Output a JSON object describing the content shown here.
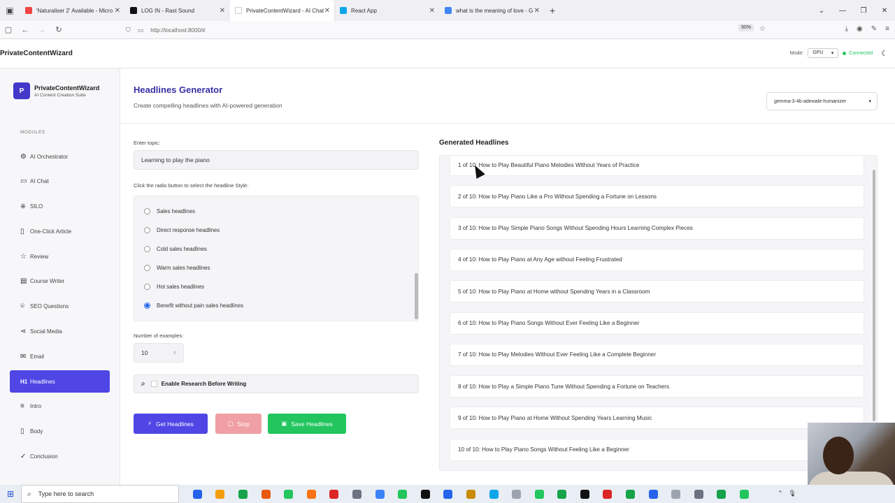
{
  "browser": {
    "tabs": [
      {
        "label": "'Naturaliser 2' Available - Micro",
        "color": "#ef4444"
      },
      {
        "label": "LOG IN - Rast Sound",
        "color": "#111111"
      },
      {
        "label": "PrivateContentWizard - AI Chat",
        "color": "#ffffff"
      },
      {
        "label": "React App",
        "color": "#0ea5e9"
      },
      {
        "label": "what is the meaning of love - G",
        "color": "#4285f4"
      }
    ],
    "url": "http://localhost:8000/#",
    "zoom": "90%"
  },
  "header": {
    "app_name": "PrivateContentWizard",
    "mode_label": "Mode:",
    "mode_value": "GPU",
    "status": "Connected"
  },
  "sidebar": {
    "brand_initial": "P",
    "brand_name": "PrivateContentWizard",
    "brand_sub": "AI Content Creation Suite",
    "modules_label": "MODULES",
    "items": [
      {
        "label": "AI Orchestrator",
        "icon": "⚙"
      },
      {
        "label": "AI Chat",
        "icon": "▭"
      },
      {
        "label": "SILO",
        "icon": "⎈"
      },
      {
        "label": "One-Click Article",
        "icon": "▯"
      },
      {
        "label": "Review",
        "icon": "☆"
      },
      {
        "label": "Course Writer",
        "icon": "▤"
      },
      {
        "label": "SEO Questions",
        "icon": "⌾"
      },
      {
        "label": "Social Media",
        "icon": "⋖"
      },
      {
        "label": "Email",
        "icon": "✉"
      },
      {
        "label": "Headlines",
        "icon": "H1"
      },
      {
        "label": "Intro",
        "icon": "≡"
      },
      {
        "label": "Body",
        "icon": "▯"
      },
      {
        "label": "Conclusion",
        "icon": "✓"
      }
    ]
  },
  "page": {
    "title": "Headlines Generator",
    "subtitle": "Create compelling headlines with AI-powered generation",
    "model": "gemma-3-4b-adewale-humanizer",
    "topic_label": "Enter topic:",
    "topic_value": "Learning to play the piano",
    "radio_label": "Click the radio button to select the headline Style:",
    "styles": [
      {
        "label": "Sales headlines",
        "checked": false
      },
      {
        "label": "Direct response headlines",
        "checked": false
      },
      {
        "label": "Cold sales headlines",
        "checked": false
      },
      {
        "label": "Warm sales headlines",
        "checked": false
      },
      {
        "label": "Hot sales headlines",
        "checked": false
      },
      {
        "label": "Benefit without pain sales headlines",
        "checked": true
      }
    ],
    "examples_label": "Number of examples:",
    "examples_value": "10",
    "research_label": "Enable Research Before Writing",
    "buttons": {
      "get": "Get Headlines",
      "stop": "Stop",
      "save": "Save Headlines"
    },
    "generated_title": "Generated Headlines",
    "headlines": [
      "1 of 10: How to Play Beautiful Piano Melodies Without Years of Practice",
      "2 of 10: How to Play Piano Like a Pro Without Spending a Fortune on Lessons",
      "3 of 10: How to Play Simple Piano Songs Without Spending Hours Learning Complex Pieces",
      "4 of 10: How to Play Piano at Any Age without Feeling Frustrated",
      "5 of 10: How to Play Piano at Home without Spending Years in a Classroom",
      "6 of 10: How to Play Piano Songs Without Ever Feeling Like a Beginner",
      "7 of 10: How to Play Melodies Without Ever Feeling Like a Complete Beginner",
      "8 of 10: How to Play a Simple Piano Tune Without Spending a Fortune on Teachers",
      "9 of 10: How to Play Piano at Home Without Spending Years Learning Music",
      "10 of 10: How to Play Piano Songs Without Feeling Like a Beginner"
    ]
  },
  "taskbar": {
    "search_placeholder": "Type here to search",
    "apps": [
      "#2563eb",
      "#f59e0b",
      "#16a34a",
      "#ea580c",
      "#22c55e",
      "#f97316",
      "#dc2626",
      "#6b7280",
      "#3b82f6",
      "#22c55e",
      "#111111",
      "#2563eb",
      "#ca8a04",
      "#0ea5e9",
      "#9ca3af",
      "#22c55e",
      "#16a34a",
      "#111111",
      "#dc2626",
      "#16a34a",
      "#2563eb",
      "#9ca3af",
      "#6b7280",
      "#16a34a",
      "#22c55e"
    ]
  }
}
